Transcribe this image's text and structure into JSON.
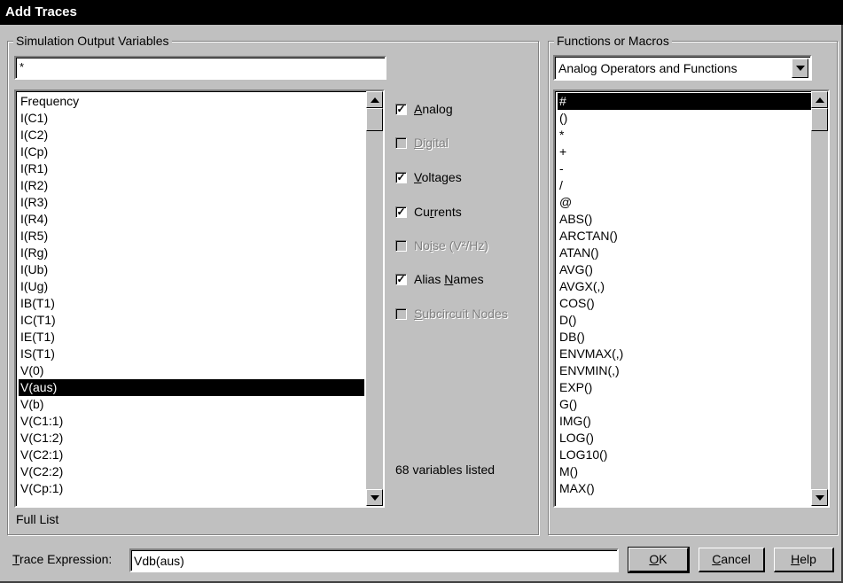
{
  "window": {
    "title": "Add Traces"
  },
  "output_vars": {
    "group_label": "Simulation Output Variables",
    "filter_value": "*",
    "items": [
      "Frequency",
      "I(C1)",
      "I(C2)",
      "I(Cp)",
      "I(R1)",
      "I(R2)",
      "I(R3)",
      "I(R4)",
      "I(R5)",
      "I(Rg)",
      "I(Ub)",
      "I(Ug)",
      "IB(T1)",
      "IC(T1)",
      "IE(T1)",
      "IS(T1)",
      "V(0)",
      "V(aus)",
      "V(b)",
      "V(C1:1)",
      "V(C1:2)",
      "V(C2:1)",
      "V(C2:2)",
      "V(Cp:1)"
    ],
    "selected_index": 17,
    "footer": "Full List"
  },
  "filters": {
    "analog": {
      "label": "Analog",
      "checked": true
    },
    "digital": {
      "label": "Digital",
      "checked": false
    },
    "voltages": {
      "label": "Voltages",
      "checked": true
    },
    "currents": {
      "label": "Currents",
      "checked": true
    },
    "noise": {
      "label": "Noise (V²/Hz)",
      "checked": false
    },
    "alias": {
      "label": "Alias Names",
      "checked": true
    },
    "subcircuit": {
      "label": "Subcircuit Nodes",
      "checked": false
    },
    "count_text": "68 variables listed"
  },
  "functions": {
    "group_label": "Functions or Macros",
    "dropdown_value": "Analog Operators and Functions",
    "items": [
      "#",
      "()",
      "*",
      "+",
      "-",
      "/",
      "@",
      "ABS()",
      "ARCTAN()",
      "ATAN()",
      "AVG()",
      "AVGX(,)",
      "COS()",
      "D()",
      "DB()",
      "ENVMAX(,)",
      "ENVMIN(,)",
      "EXP()",
      "G()",
      "IMG()",
      "LOG()",
      "LOG10()",
      "M()",
      "MAX()"
    ],
    "selected_index": 0
  },
  "bottom": {
    "trace_label": "Trace Expression:",
    "trace_value": "Vdb(aus)",
    "ok_label": "OK",
    "cancel_label": "Cancel",
    "help_label": "Help"
  }
}
